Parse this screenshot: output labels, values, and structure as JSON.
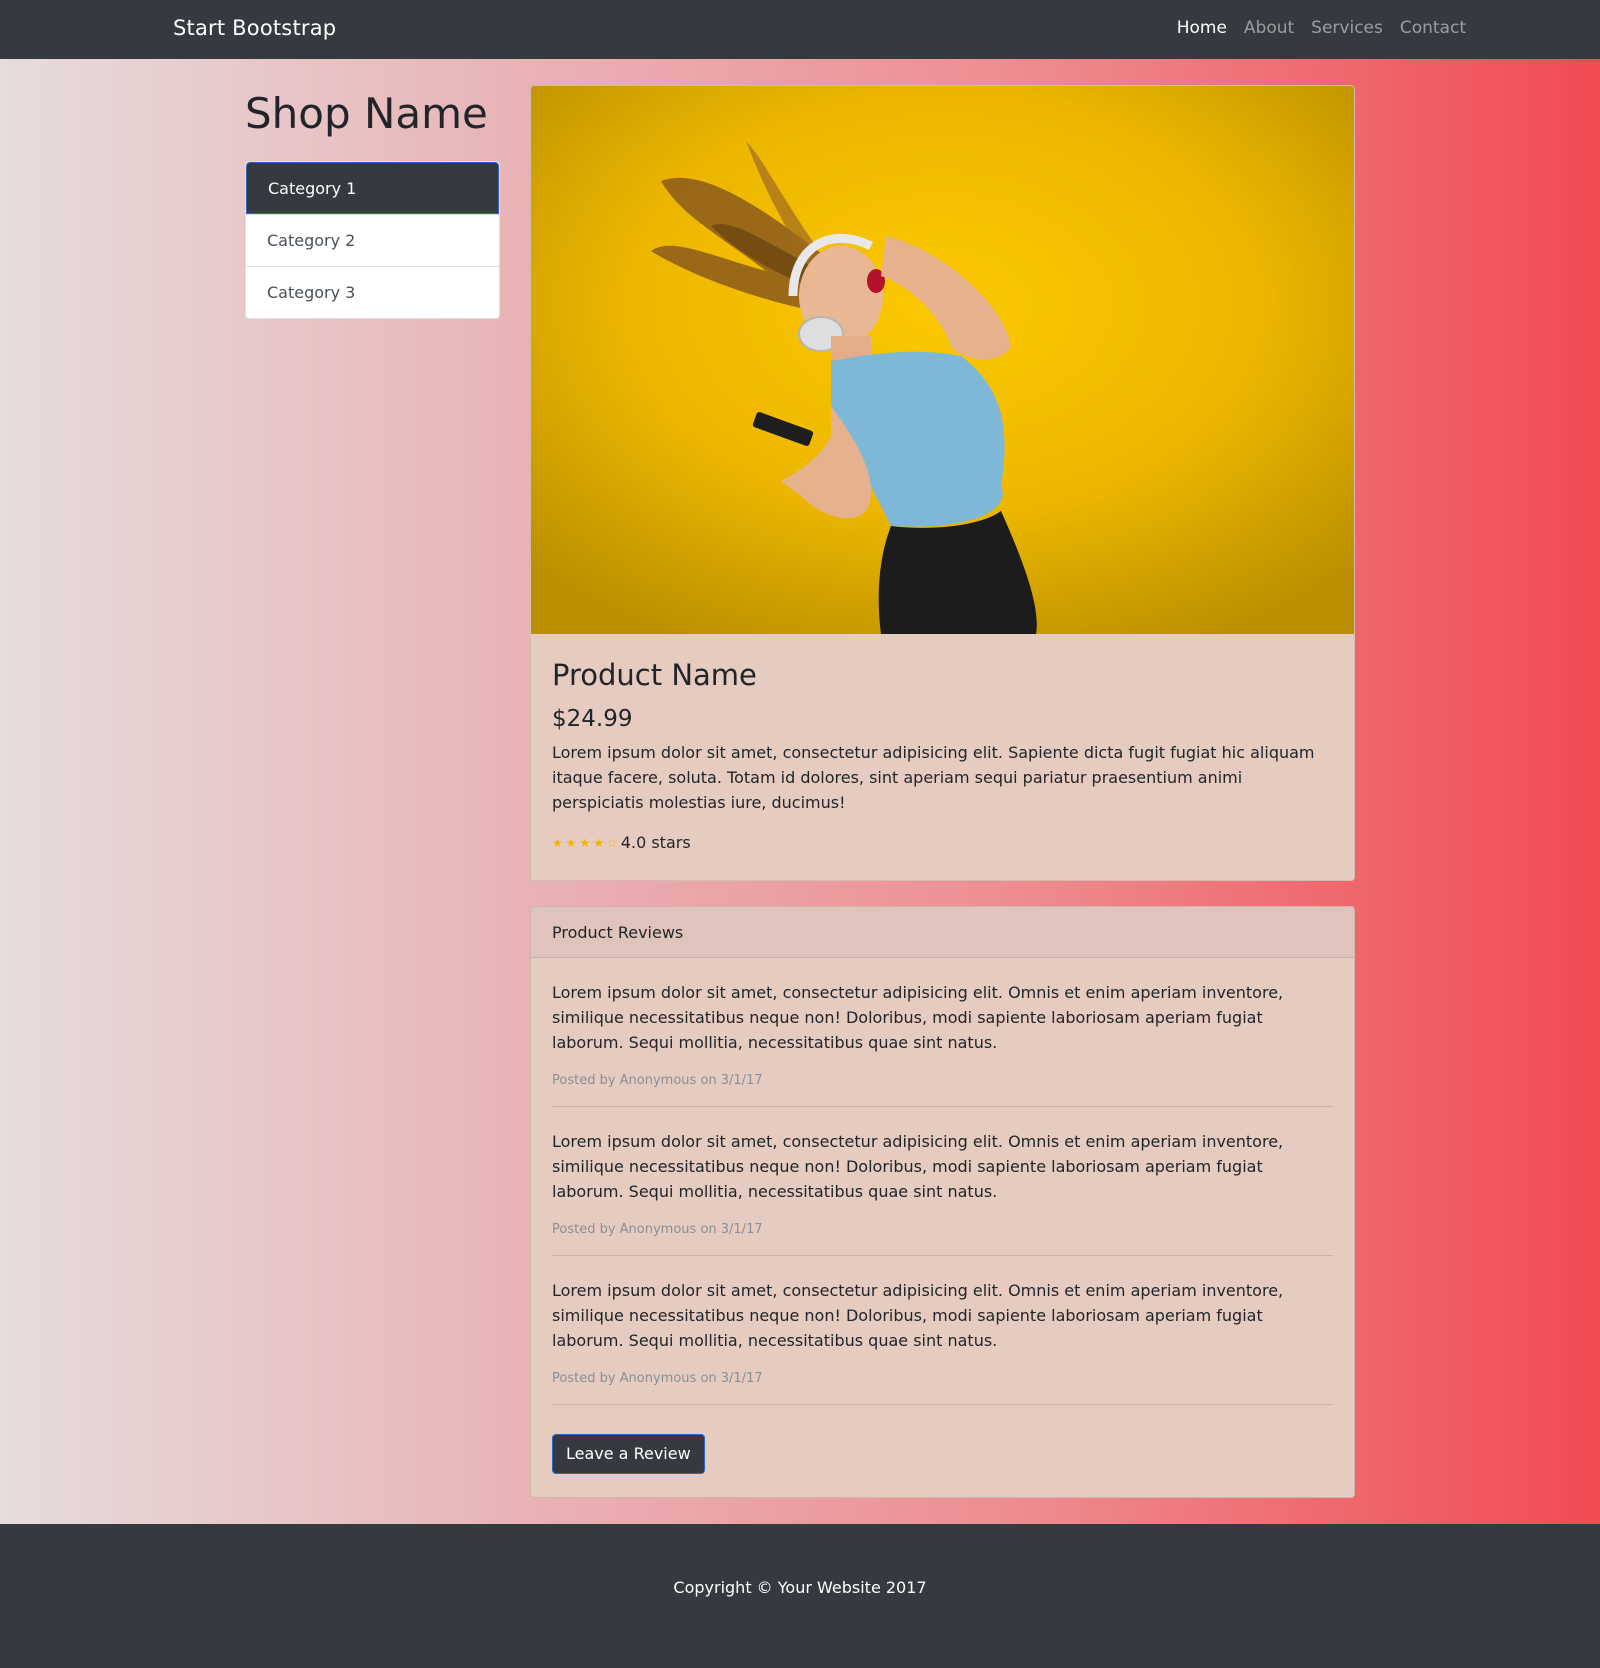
{
  "navbar": {
    "brand": "Start Bootstrap",
    "links": [
      {
        "label": "Home",
        "active": true
      },
      {
        "label": "About"
      },
      {
        "label": "Services"
      },
      {
        "label": "Contact"
      }
    ]
  },
  "sidebar": {
    "shop_name": "Shop Name",
    "categories": [
      {
        "label": "Category 1",
        "active": true
      },
      {
        "label": "Category 2"
      },
      {
        "label": "Category 3"
      }
    ]
  },
  "product": {
    "image_icon": "product-photo-woman-headphones",
    "name": "Product Name",
    "price": "$24.99",
    "description": "Lorem ipsum dolor sit amet, consectetur adipisicing elit. Sapiente dicta fugit fugiat hic aliquam itaque facere, soluta. Totam id dolores, sint aperiam sequi pariatur praesentium animi perspiciatis molestias iure, ducimus!",
    "stars": "★★★★☆",
    "rating_text": "4.0 stars",
    "rating_value": 4
  },
  "reviews": {
    "header": "Product Reviews",
    "items": [
      {
        "text": "Lorem ipsum dolor sit amet, consectetur adipisicing elit. Omnis et enim aperiam inventore, similique necessitatibus neque non! Doloribus, modi sapiente laboriosam aperiam fugiat laborum. Sequi mollitia, necessitatibus quae sint natus.",
        "meta": "Posted by Anonymous on 3/1/17"
      },
      {
        "text": "Lorem ipsum dolor sit amet, consectetur adipisicing elit. Omnis et enim aperiam inventore, similique necessitatibus neque non! Doloribus, modi sapiente laboriosam aperiam fugiat laborum. Sequi mollitia, necessitatibus quae sint natus.",
        "meta": "Posted by Anonymous on 3/1/17"
      },
      {
        "text": "Lorem ipsum dolor sit amet, consectetur adipisicing elit. Omnis et enim aperiam inventore, similique necessitatibus neque non! Doloribus, modi sapiente laboriosam aperiam fugiat laborum. Sequi mollitia, necessitatibus quae sint natus.",
        "meta": "Posted by Anonymous on 3/1/17"
      }
    ],
    "button_label": "Leave a Review"
  },
  "footer": {
    "copyright": "Copyright © Your Website 2017"
  },
  "colors": {
    "dark": "#343a40",
    "accent_border": "#2f66c3",
    "star": "#f0b400",
    "gradient_start": "#e6dcdc",
    "gradient_end": "#f04b51"
  }
}
